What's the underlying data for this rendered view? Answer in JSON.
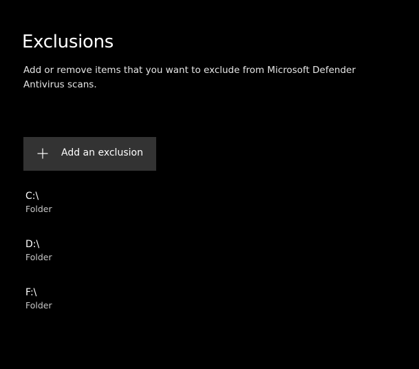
{
  "page": {
    "title": "Exclusions",
    "description": "Add or remove items that you want to exclude from Microsoft Defender Antivirus scans."
  },
  "add_button": {
    "label": "Add an exclusion",
    "icon": "plus-icon"
  },
  "exclusions": [
    {
      "path": "C:\\",
      "type": "Folder"
    },
    {
      "path": "D:\\",
      "type": "Folder"
    },
    {
      "path": "F:\\",
      "type": "Folder"
    }
  ],
  "colors": {
    "background": "#000000",
    "button_background": "#333333",
    "primary_text": "#ffffff",
    "secondary_text": "#c8c8c8"
  }
}
